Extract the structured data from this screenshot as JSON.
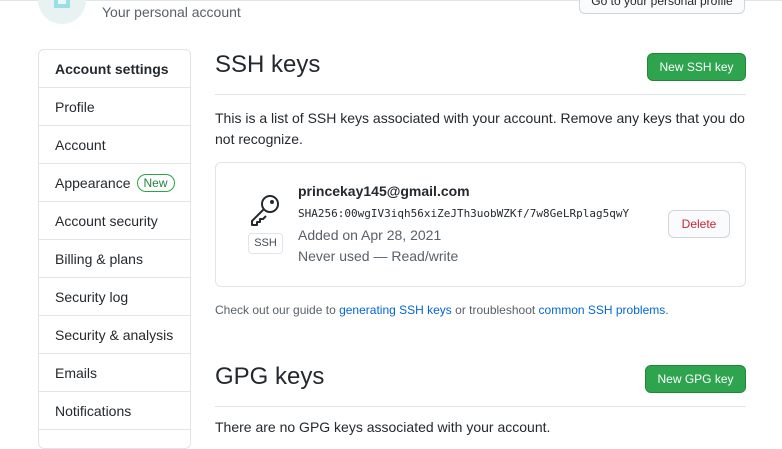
{
  "header": {
    "subtitle": "Your personal account",
    "profile_button": "Go to your personal profile"
  },
  "sidebar": {
    "items": [
      {
        "label": "Account settings"
      },
      {
        "label": "Profile"
      },
      {
        "label": "Account"
      },
      {
        "label": "Appearance",
        "badge": "New"
      },
      {
        "label": "Account security"
      },
      {
        "label": "Billing & plans"
      },
      {
        "label": "Security log"
      },
      {
        "label": "Security & analysis"
      },
      {
        "label": "Emails"
      },
      {
        "label": "Notifications"
      }
    ]
  },
  "ssh": {
    "title": "SSH keys",
    "new_button": "New SSH key",
    "description": "This is a list of SSH keys associated with your account. Remove any keys that you do not recognize.",
    "key": {
      "icon": "key-icon",
      "type_label": "SSH",
      "title": "princekay145@gmail.com",
      "fingerprint": "SHA256:00wgIV3iqh56xiZeJTh3uobWZKf/7w8GeLRplag5qwY",
      "added": "Added on Apr 28, 2021",
      "usage": "Never used — Read/write",
      "delete_button": "Delete"
    },
    "guide": {
      "prefix": "Check out our guide to ",
      "link1": "generating SSH keys",
      "middle": " or troubleshoot ",
      "link2": "common SSH problems",
      "suffix": "."
    }
  },
  "gpg": {
    "title": "GPG keys",
    "new_button": "New GPG key",
    "description_partial": "There are no GPG keys associated with your account."
  },
  "colors": {
    "primary_button": "#2ea44f",
    "link": "#0366d6",
    "danger": "#cb2431",
    "badge_green": "#28a745"
  }
}
